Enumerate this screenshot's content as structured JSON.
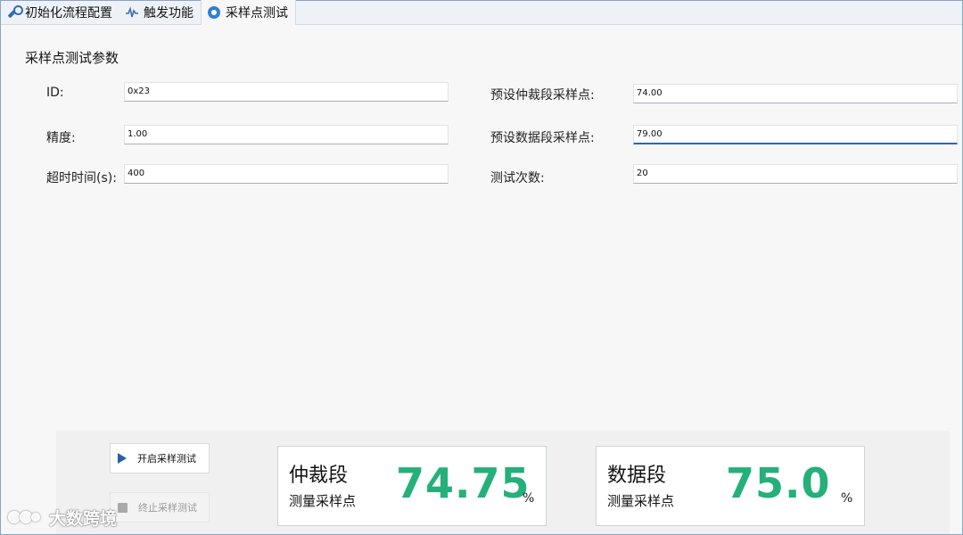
{
  "tabs": [
    {
      "label": "初始化流程配置",
      "icon": "wrench-icon"
    },
    {
      "label": "触发功能",
      "icon": "waveform-icon"
    },
    {
      "label": "采样点测试",
      "icon": "target-icon",
      "active": true
    }
  ],
  "section_title": "采样点测试参数",
  "fields_left": [
    {
      "label": "ID:",
      "value": "0x23"
    },
    {
      "label": "精度:",
      "value": "1.00"
    },
    {
      "label": "超时时间(s):",
      "value": "400"
    }
  ],
  "fields_right": [
    {
      "label": "预设仲裁段采样点:",
      "value": "74.00"
    },
    {
      "label": "预设数据段采样点:",
      "value": "79.00"
    },
    {
      "label": "测试次数:",
      "value": "20"
    }
  ],
  "buttons": {
    "start_label": "开启采样测试",
    "stop_label": "终止采样测试"
  },
  "results": [
    {
      "title": "仲裁段",
      "subtitle": "测量采样点",
      "value": "74.75",
      "unit": "%"
    },
    {
      "title": "数据段",
      "subtitle": "测量采样点",
      "value": "75.0",
      "unit": "%"
    }
  ],
  "watermark_text": "大数跨境",
  "colors": {
    "accent": "#2a66b8",
    "value_green": "#24b07a"
  }
}
